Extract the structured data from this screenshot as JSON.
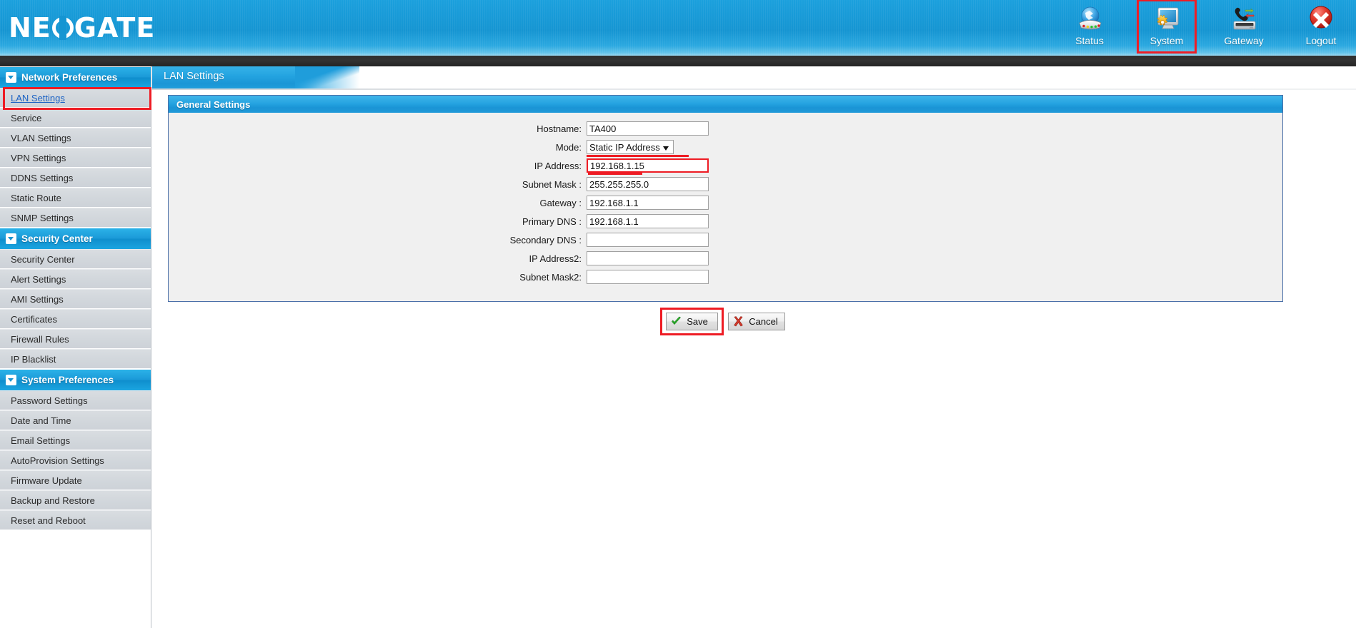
{
  "brand": {
    "name_before": "NE",
    "name_after": "GATE"
  },
  "topnav": [
    {
      "label": "Status",
      "icon": "globe-status-icon",
      "selected": false
    },
    {
      "label": "System",
      "icon": "monitor-gear-icon",
      "selected": true
    },
    {
      "label": "Gateway",
      "icon": "phone-gateway-icon",
      "selected": false
    },
    {
      "label": "Logout",
      "icon": "logout-cross-icon",
      "selected": false
    }
  ],
  "sidebar": {
    "groups": [
      {
        "label": "Network Preferences",
        "items": [
          {
            "label": "LAN Settings",
            "active": true,
            "annotated": true
          },
          {
            "label": "Service",
            "active": false,
            "annotated": false
          },
          {
            "label": "VLAN Settings",
            "active": false,
            "annotated": false
          },
          {
            "label": "VPN Settings",
            "active": false,
            "annotated": false
          },
          {
            "label": "DDNS Settings",
            "active": false,
            "annotated": false
          },
          {
            "label": "Static Route",
            "active": false,
            "annotated": false
          },
          {
            "label": "SNMP Settings",
            "active": false,
            "annotated": false
          }
        ]
      },
      {
        "label": "Security Center",
        "items": [
          {
            "label": "Security Center",
            "active": false,
            "annotated": false
          },
          {
            "label": "Alert Settings",
            "active": false,
            "annotated": false
          },
          {
            "label": "AMI Settings",
            "active": false,
            "annotated": false
          },
          {
            "label": "Certificates",
            "active": false,
            "annotated": false
          },
          {
            "label": "Firewall Rules",
            "active": false,
            "annotated": false
          },
          {
            "label": "IP Blacklist",
            "active": false,
            "annotated": false
          }
        ]
      },
      {
        "label": "System Preferences",
        "items": [
          {
            "label": "Password Settings",
            "active": false,
            "annotated": false
          },
          {
            "label": "Date and Time",
            "active": false,
            "annotated": false
          },
          {
            "label": "Email Settings",
            "active": false,
            "annotated": false
          },
          {
            "label": "AutoProvision Settings",
            "active": false,
            "annotated": false
          },
          {
            "label": "Firmware Update",
            "active": false,
            "annotated": false
          },
          {
            "label": "Backup and Restore",
            "active": false,
            "annotated": false
          },
          {
            "label": "Reset and Reboot",
            "active": false,
            "annotated": false
          }
        ]
      }
    ]
  },
  "tab": {
    "label": "LAN Settings"
  },
  "panel": {
    "title": "General Settings",
    "fields": [
      {
        "label": "Hostname:",
        "type": "text",
        "value": "TA400",
        "annotated": false,
        "underline": false
      },
      {
        "label": "Mode:",
        "type": "select",
        "value": "Static IP Address",
        "annotated": false,
        "underline": true
      },
      {
        "label": "IP Address:",
        "type": "text",
        "value": "192.168.1.15",
        "annotated": true,
        "underline": true
      },
      {
        "label": "Subnet Mask :",
        "type": "text",
        "value": "255.255.255.0",
        "annotated": false,
        "underline": false
      },
      {
        "label": "Gateway :",
        "type": "text",
        "value": "192.168.1.1",
        "annotated": false,
        "underline": false
      },
      {
        "label": "Primary DNS :",
        "type": "text",
        "value": "192.168.1.1",
        "annotated": false,
        "underline": false
      },
      {
        "label": "Secondary DNS :",
        "type": "text",
        "value": "",
        "annotated": false,
        "underline": false
      },
      {
        "label": "IP Address2:",
        "type": "text",
        "value": "",
        "annotated": false,
        "underline": false
      },
      {
        "label": "Subnet Mask2:",
        "type": "text",
        "value": "",
        "annotated": false,
        "underline": false
      }
    ]
  },
  "buttons": [
    {
      "label": "Save",
      "icon": "green-check-icon",
      "annotated": true
    },
    {
      "label": "Cancel",
      "icon": "red-x-icon",
      "annotated": false
    }
  ],
  "colors": {
    "brand_blue": "#1595d2",
    "panel_blue": "#26a4e1",
    "annotation_red": "#ee1c24",
    "sidebar_item_bg": "#d2d7dc",
    "link_blue": "#1b62c4"
  }
}
